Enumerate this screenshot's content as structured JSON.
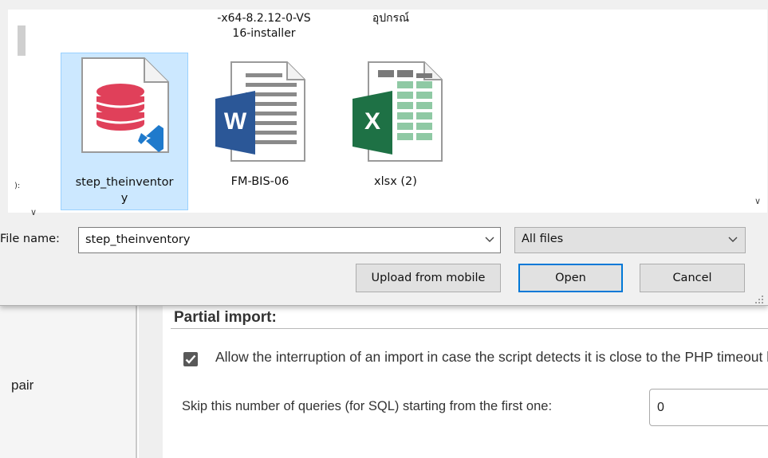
{
  "dialog": {
    "files_top_row": [
      {
        "label": "-x64-8.2.12-0-VS\n16-installer"
      },
      {
        "label": "อุปกรณ์"
      }
    ],
    "files": [
      {
        "name": "step_theinventor\ny",
        "icon": "sql-database-file-icon",
        "selected": true,
        "accent": "#e0405a"
      },
      {
        "name": "FM-BIS-06",
        "icon": "word-document-icon",
        "selected": false,
        "accent": "#2b5797"
      },
      {
        "name": "xlsx (2)",
        "icon": "excel-spreadsheet-icon",
        "selected": false,
        "accent": "#1e7145"
      }
    ],
    "left_strip_text": "):",
    "file_name_label": "File name:",
    "file_name_value": "step_theinventory",
    "file_type_value": "All files",
    "buttons": {
      "upload": "Upload from mobile",
      "open": "Open",
      "cancel": "Cancel"
    },
    "colors": {
      "selection_bg": "#cce8ff",
      "selection_border": "#99d1ff",
      "focus": "#0078d7"
    }
  },
  "page": {
    "sidebar_text": "pair",
    "section_title": "Partial import:",
    "allow_interrupt_checked": true,
    "allow_interrupt_label": "Allow the interruption of an import in case the script detects it is close to the PHP timeout limit.",
    "skip_label": "Skip this number of queries (for SQL) starting from the first one:",
    "skip_value": "0"
  }
}
